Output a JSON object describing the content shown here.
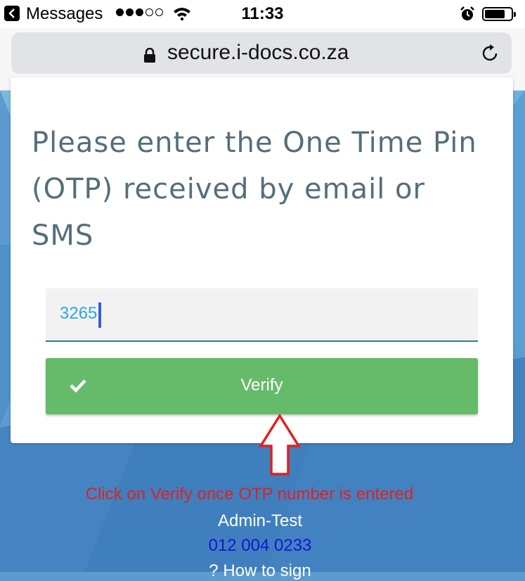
{
  "status_bar": {
    "back_app": "Messages",
    "time": "11:33"
  },
  "browser": {
    "url": "secure.i-docs.co.za"
  },
  "card": {
    "heading": "Please enter the One Time Pin (OTP) received by email or SMS",
    "otp_value": "3265",
    "verify_label": "Verify"
  },
  "annotation": {
    "text": "Click on Verify once OTP number is entered",
    "color": "#e02020"
  },
  "footer": {
    "name": "Admin-Test",
    "phone": "012 004 0233",
    "help_text": "? How to sign"
  },
  "colors": {
    "verify_button": "#66bb6a",
    "heading": "#546e7a",
    "otp_text": "#29a8e0",
    "background": "#5b9bd0"
  }
}
